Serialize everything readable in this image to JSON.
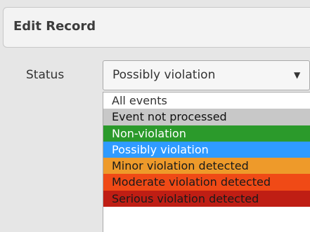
{
  "dialog": {
    "title": "Edit Record"
  },
  "form": {
    "status_label": "Status",
    "status_selected": "Possibly violation"
  },
  "dropdown": {
    "options": [
      {
        "label": "All events",
        "bg": "#ffffff",
        "fg": "#333333"
      },
      {
        "label": "Event not processed",
        "bg": "#c8c8c8",
        "fg": "#111111"
      },
      {
        "label": "Non-violation",
        "bg": "#2b9a2b",
        "fg": "#ffffff"
      },
      {
        "label": "Possibly violation",
        "bg": "#2f9bff",
        "fg": "#ffffff",
        "selected": true
      },
      {
        "label": "Minor violation detected",
        "bg": "#ee9a2a",
        "fg": "#1a1a1a"
      },
      {
        "label": "Moderate violation detected",
        "bg": "#f04a16",
        "fg": "#1a1a1a"
      },
      {
        "label": "Serious violation detected",
        "bg": "#bf1e14",
        "fg": "#1a1a1a"
      },
      {
        "label": "",
        "bg": "#ffffff",
        "fg": "#333333"
      }
    ]
  },
  "icons": {
    "select_arrow": "chevron-down-icon"
  }
}
